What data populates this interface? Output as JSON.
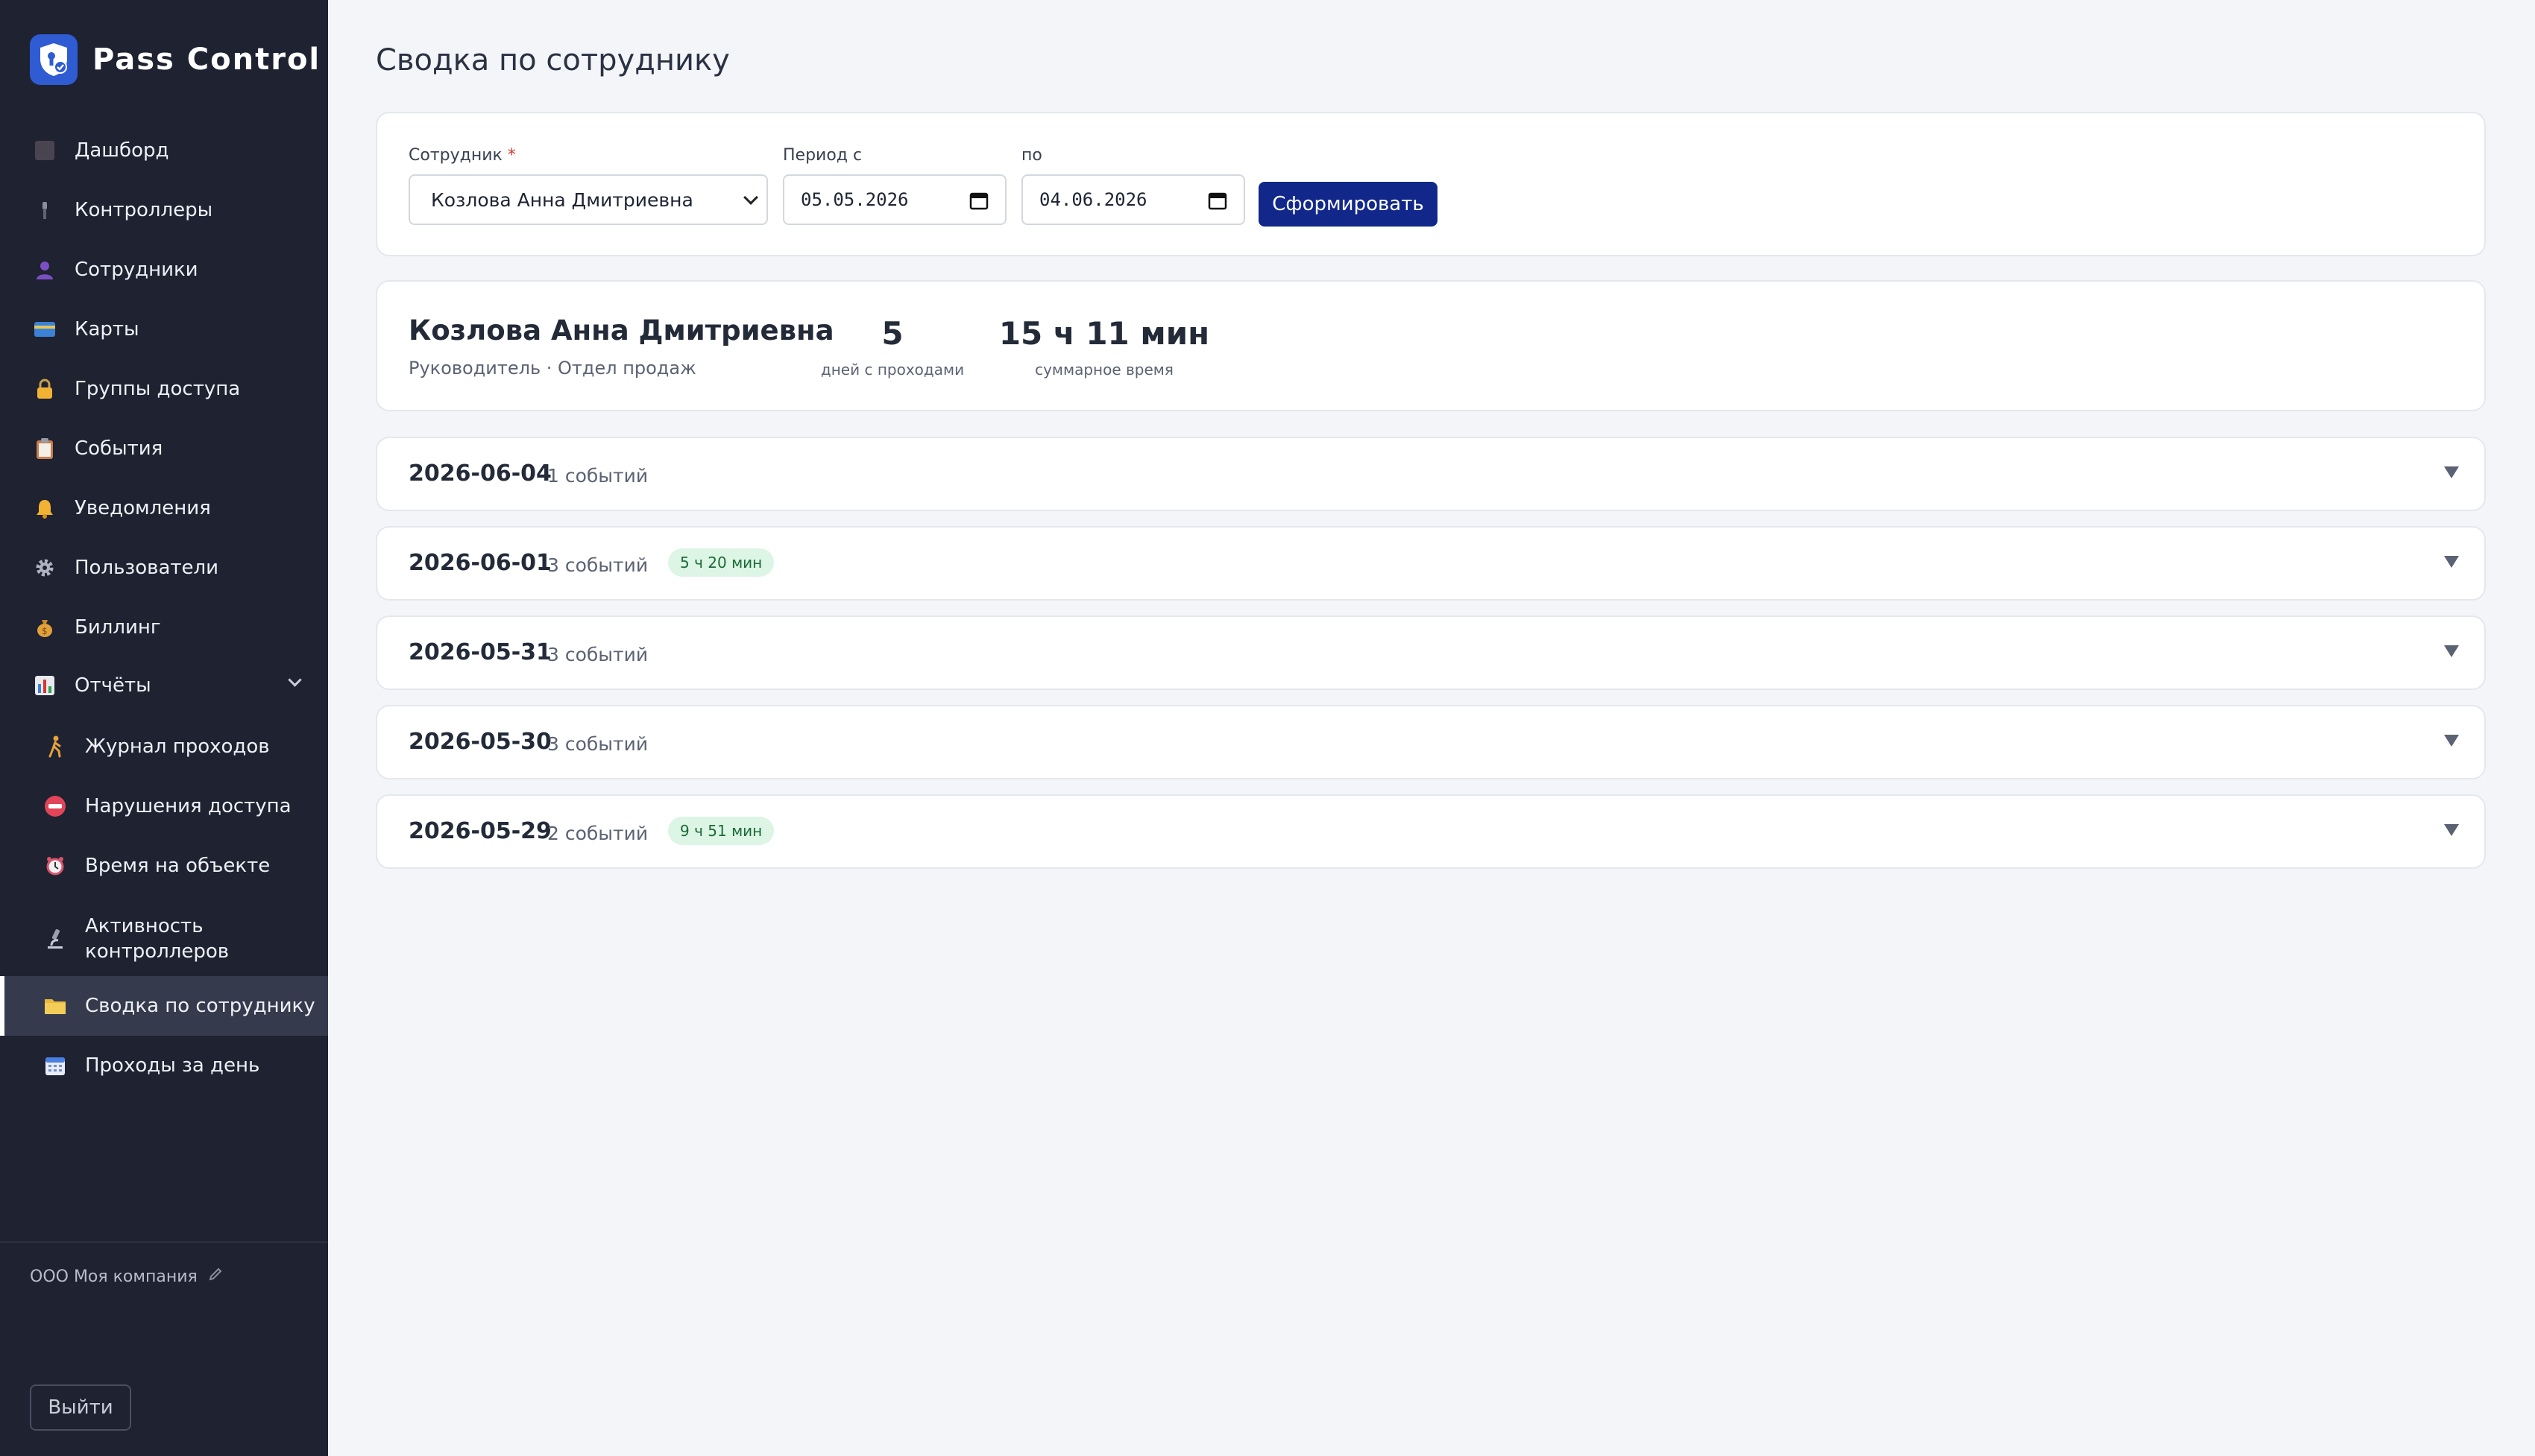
{
  "app": {
    "name": "Pass Control",
    "company": "ООО Моя компания",
    "logout_label": "Выйти"
  },
  "sidebar": {
    "items": [
      {
        "label": "Дашборд",
        "icon": "dashboard-icon"
      },
      {
        "label": "Контроллеры",
        "icon": "controller-icon"
      },
      {
        "label": "Сотрудники",
        "icon": "person-icon"
      },
      {
        "label": "Карты",
        "icon": "card-icon"
      },
      {
        "label": "Группы доступа",
        "icon": "lock-icon"
      },
      {
        "label": "События",
        "icon": "clipboard-icon"
      },
      {
        "label": "Уведомления",
        "icon": "bell-icon"
      },
      {
        "label": "Пользователи",
        "icon": "gear-icon"
      },
      {
        "label": "Биллинг",
        "icon": "money-bag-icon"
      },
      {
        "label": "Отчёты",
        "icon": "bar-chart-icon",
        "expanded": true
      }
    ],
    "reports": [
      {
        "label": "Журнал проходов",
        "icon": "walking-person-icon"
      },
      {
        "label": "Нарушения доступа",
        "icon": "no-entry-icon"
      },
      {
        "label": "Время на объекте",
        "icon": "alarm-clock-icon"
      },
      {
        "label_line1": "Активность",
        "label_line2": "контроллеров",
        "icon": "microscope-icon"
      },
      {
        "label": "Сводка по сотруднику",
        "icon": "folder-icon",
        "active": true
      },
      {
        "label": "Проходы за день",
        "icon": "calendar-icon"
      }
    ]
  },
  "page": {
    "title": "Сводка по сотруднику"
  },
  "filters": {
    "employee_label": "Сотрудник",
    "required_mark": "*",
    "employee_value": "Козлова Анна Дмитриевна",
    "period_from_label": "Период с",
    "period_from_value": "05.05.2026",
    "period_to_label": "по",
    "period_to_value": "04.06.2026",
    "submit_label": "Сформировать"
  },
  "summary": {
    "name": "Козлова Анна Дмитриевна",
    "subtitle": "Руководитель · Отдел продаж",
    "days_value": "5",
    "days_caption": "дней с проходами",
    "total_value": "15 ч 11 мин",
    "total_caption": "суммарное время"
  },
  "days": [
    {
      "date": "2026-06-04",
      "events": "1 событий",
      "duration": ""
    },
    {
      "date": "2026-06-01",
      "events": "3 событий",
      "duration": "5 ч 20 мин"
    },
    {
      "date": "2026-05-31",
      "events": "3 событий",
      "duration": ""
    },
    {
      "date": "2026-05-30",
      "events": "3 событий",
      "duration": ""
    },
    {
      "date": "2026-05-29",
      "events": "2 событий",
      "duration": "9 ч 51 мин"
    }
  ],
  "colors": {
    "sidebar_bg": "#1e2231",
    "primary": "#11288a",
    "badge_bg": "#dcf5e4",
    "badge_text": "#1b6a37",
    "required": "#d9362b"
  }
}
